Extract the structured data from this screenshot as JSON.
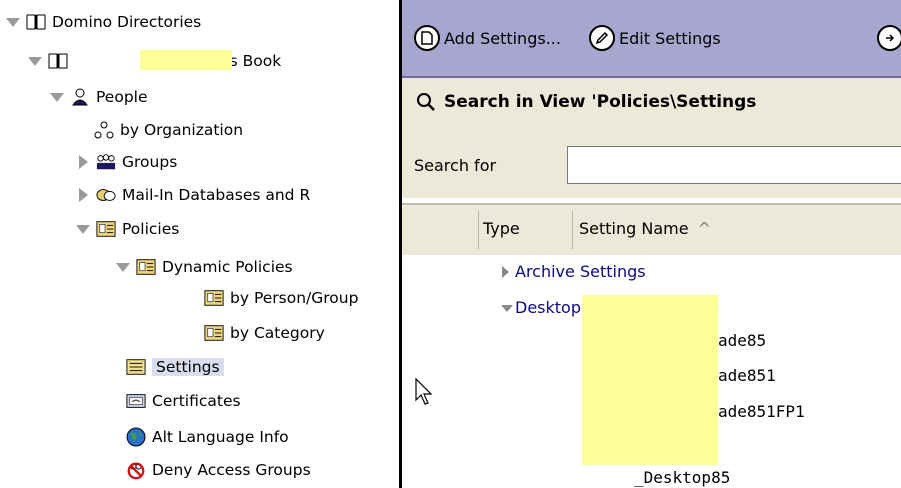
{
  "tree": {
    "root": "Domino Directories",
    "address_book": "Address Book",
    "items": [
      {
        "label": "People",
        "expanded": true
      },
      {
        "label": "by Organization"
      },
      {
        "label": "Groups",
        "expanded": false
      },
      {
        "label": "Mail-In Databases and R",
        "expanded": false
      },
      {
        "label": "Policies",
        "expanded": true
      },
      {
        "label": "Dynamic Policies",
        "expanded": true
      },
      {
        "label": "by Person/Group"
      },
      {
        "label": "by Category"
      },
      {
        "label": "Settings",
        "selected": true
      },
      {
        "label": "Certificates"
      },
      {
        "label": "Alt Language Info"
      },
      {
        "label": "Deny Access Groups"
      }
    ]
  },
  "toolbar": {
    "add_settings": "Add Settings...",
    "edit_settings": "Edit Settings"
  },
  "search": {
    "title": "Search in View 'Policies\\Settings",
    "label": "Search for",
    "value": ""
  },
  "columns": {
    "type": "Type",
    "setting_name": "Setting Name",
    "sort_indicator": "^"
  },
  "view": {
    "categories": [
      {
        "label": "Archive Settings",
        "expanded": false
      },
      {
        "label": "Desktop Settings",
        "expanded": true
      }
    ],
    "docs": [
      "ade85",
      "ade851",
      "ade851FP1",
      "",
      "_Desktop85"
    ]
  },
  "colors": {
    "action_bar": "#a8a6cf",
    "redaction": "#ffff99",
    "category_text": "#0a0a8a",
    "selection": "#dcdcf0"
  }
}
